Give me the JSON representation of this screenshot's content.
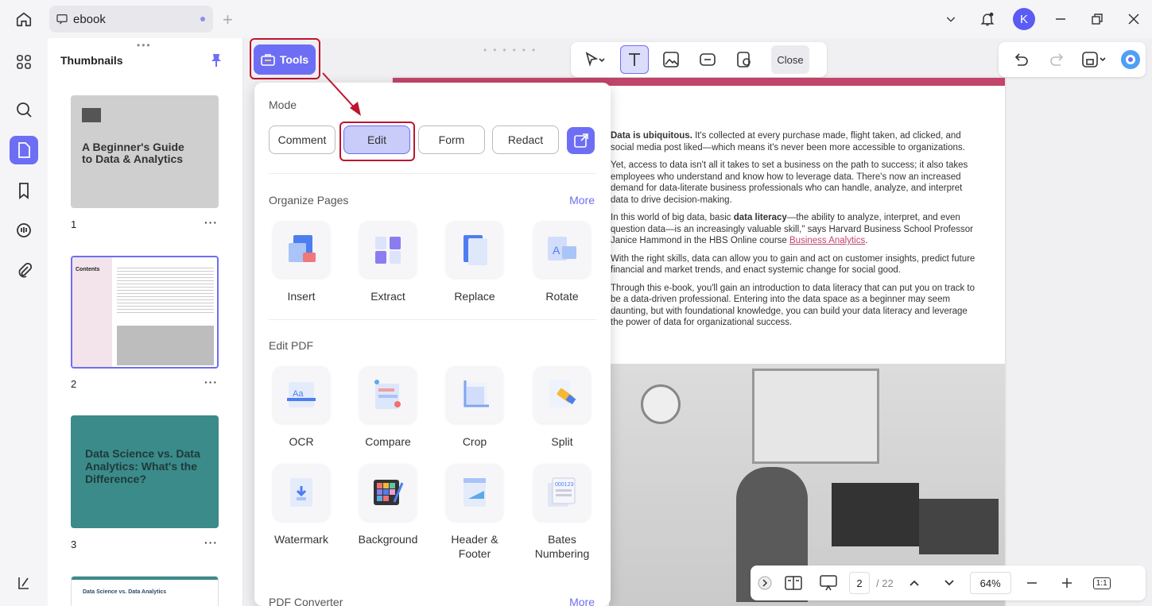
{
  "tab": {
    "title": "ebook"
  },
  "avatar_letter": "K",
  "thumbnails": {
    "title": "Thumbnails",
    "pages": [
      {
        "number": "1",
        "heading": "A Beginner's Guide to Data & Analytics"
      },
      {
        "number": "2",
        "heading": "Contents"
      },
      {
        "number": "3",
        "heading": "Data Science vs. Data Analytics: What's the Difference?"
      },
      {
        "number": "",
        "heading": "Data Science vs. Data Analytics"
      }
    ]
  },
  "tools_button": "Tools",
  "toolbar": {
    "close": "Close"
  },
  "panel": {
    "mode_title": "Mode",
    "modes": [
      "Comment",
      "Edit",
      "Form",
      "Redact"
    ],
    "organize": {
      "title": "Organize Pages",
      "more": "More",
      "tools": [
        "Insert",
        "Extract",
        "Replace",
        "Rotate"
      ]
    },
    "edit_pdf": {
      "title": "Edit PDF",
      "tools": [
        "OCR",
        "Compare",
        "Crop",
        "Split",
        "Watermark",
        "Background",
        "Header & Footer",
        "Bates Numbering"
      ]
    },
    "converter": {
      "title": "PDF Converter",
      "more": "More"
    }
  },
  "document": {
    "paragraphs": [
      {
        "bold": "Data is ubiquitous.",
        "text": " It's collected at every purchase made, flight taken, ad clicked, and social media post liked—which means it's never been more accessible to organizations."
      },
      {
        "bold": "",
        "text": "Yet, access to data isn't all it takes to set a business on the path to success; it also takes employees who understand and know how to leverage data. There's now an increased demand for data-literate business professionals who can handle, analyze, and interpret data to drive decision-making."
      },
      {
        "bold": "",
        "text": "In this world of big data, basic ",
        "bold2": "data literacy",
        "text2": "—the ability to analyze, interpret, and even question data—is an increasingly valuable skill,\" says Harvard Business School Professor Janice Hammond in the HBS Online course ",
        "link": "Business Analytics",
        "text3": "."
      },
      {
        "bold": "",
        "text": "With the right skills, data can allow you to gain and act on customer insights, predict future financial and market trends, and enact systemic change for social good."
      },
      {
        "bold": "",
        "text": "Through this e-book, you'll gain an introduction to data literacy that can put you on track to be a data-driven professional. Entering into the data space as a beginner may seem daunting, but with foundational knowledge, you can build your data literacy and leverage the power of data for organizational success."
      }
    ]
  },
  "bottombar": {
    "page_current": "2",
    "page_total": "/ 22",
    "zoom": "64%",
    "fit": "1:1"
  },
  "colors": {
    "accent": "#6e6ef5",
    "highlight": "#c0142e",
    "page_band": "#c2456a"
  }
}
